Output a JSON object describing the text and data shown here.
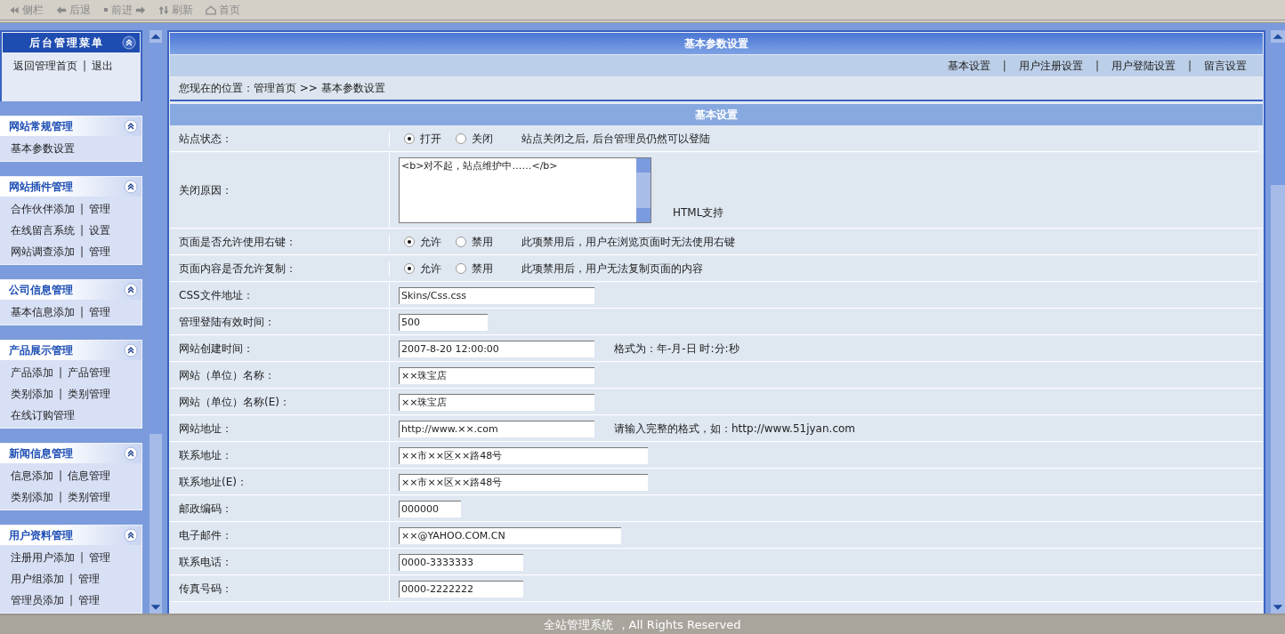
{
  "toolbar": [
    {
      "kind": "sidebar",
      "label": "侧栏"
    },
    {
      "kind": "back",
      "label": "后退"
    },
    {
      "kind": "forward",
      "label": "前进"
    },
    {
      "kind": "refresh",
      "label": "刷新"
    },
    {
      "kind": "home",
      "label": "首页"
    }
  ],
  "sidebar": {
    "separator": "|",
    "groups": [
      {
        "kind": "main",
        "title": "后台管理菜单",
        "expanded": true,
        "lines": [
          [
            "返回管理首页",
            "退出"
          ]
        ]
      },
      {
        "kind": "section",
        "title": "网站常规管理",
        "expanded": true,
        "lines": [
          [
            "基本参数设置"
          ]
        ]
      },
      {
        "kind": "section",
        "title": "网站插件管理",
        "expanded": true,
        "lines": [
          [
            "合作伙伴添加",
            "管理"
          ],
          [
            "在线留言系统",
            "设置"
          ],
          [
            "网站调查添加",
            "管理"
          ]
        ]
      },
      {
        "kind": "section",
        "title": "公司信息管理",
        "expanded": true,
        "lines": [
          [
            "基本信息添加",
            "管理"
          ]
        ]
      },
      {
        "kind": "section",
        "title": "产品展示管理",
        "expanded": true,
        "lines": [
          [
            "产品添加",
            "产品管理"
          ],
          [
            "类别添加",
            "类别管理"
          ],
          [
            "在线订购管理"
          ]
        ]
      },
      {
        "kind": "section",
        "title": "新闻信息管理",
        "expanded": true,
        "lines": [
          [
            "信息添加",
            "信息管理"
          ],
          [
            "类别添加",
            "类别管理"
          ]
        ]
      },
      {
        "kind": "section",
        "title": "用户资料管理",
        "expanded": true,
        "lines": [
          [
            "注册用户添加",
            "管理"
          ],
          [
            "用户组添加",
            "管理"
          ],
          [
            "管理员添加",
            "管理"
          ]
        ]
      }
    ]
  },
  "main": {
    "title": "基本参数设置",
    "tabs": {
      "separator": "|",
      "items": [
        "基本设置",
        "用户注册设置",
        "用户登陆设置",
        "留言设置"
      ]
    },
    "breadcrumb": "您现在的位置：管理首页 >> 基本参数设置",
    "section_title": "基本设置",
    "rows": [
      {
        "kind": "radio",
        "label": "站点状态：",
        "options": [
          {
            "label": "打开",
            "selected": true
          },
          {
            "label": "关闭",
            "selected": false
          }
        ],
        "note": "站点关闭之后, 后台管理员仍然可以登陆"
      },
      {
        "kind": "textarea",
        "label": "关闭原因：",
        "value": "<b>对不起，站点维护中……</b>",
        "note": "HTML支持"
      },
      {
        "kind": "radio",
        "label": "页面是否允许使用右键：",
        "options": [
          {
            "label": "允许",
            "selected": true
          },
          {
            "label": "禁用",
            "selected": false
          }
        ],
        "note": "此项禁用后，用户在浏览页面时无法使用右键"
      },
      {
        "kind": "radio",
        "label": "页面内容是否允许复制：",
        "options": [
          {
            "label": "允许",
            "selected": true
          },
          {
            "label": "禁用",
            "selected": false
          }
        ],
        "note": "此项禁用后，用户无法复制页面的内容"
      },
      {
        "kind": "input",
        "label": "CSS文件地址：",
        "value": "Skins/Css.css"
      },
      {
        "kind": "input",
        "label": "管理登陆有效时间：",
        "value": "500"
      },
      {
        "kind": "input",
        "label": "网站创建时间：",
        "value": "2007-8-20 12:00:00",
        "note": "格式为：年-月-日 时:分:秒"
      },
      {
        "kind": "input",
        "label": "网站（单位）名称：",
        "value": "××珠宝店"
      },
      {
        "kind": "input",
        "label": "网站（单位）名称(E)：",
        "value": "××珠宝店"
      },
      {
        "kind": "input",
        "label": "网站地址：",
        "value": "http://www.××.com",
        "note": "请输入完整的格式，如：http://www.51jyan.com"
      },
      {
        "kind": "input",
        "label": "联系地址：",
        "value": "××市××区××路48号"
      },
      {
        "kind": "input",
        "label": "联系地址(E)：",
        "value": "××市××区××路48号"
      },
      {
        "kind": "input",
        "label": "邮政编码：",
        "value": "000000"
      },
      {
        "kind": "input",
        "label": "电子邮件：",
        "value": "××@YAHOO.COM.CN"
      },
      {
        "kind": "input",
        "label": "联系电话：",
        "value": "0000-3333333"
      },
      {
        "kind": "input",
        "label": "传真号码：",
        "value": "0000-2222222"
      }
    ]
  },
  "footer": "全站管理系统 ，All Rights Reserved"
}
